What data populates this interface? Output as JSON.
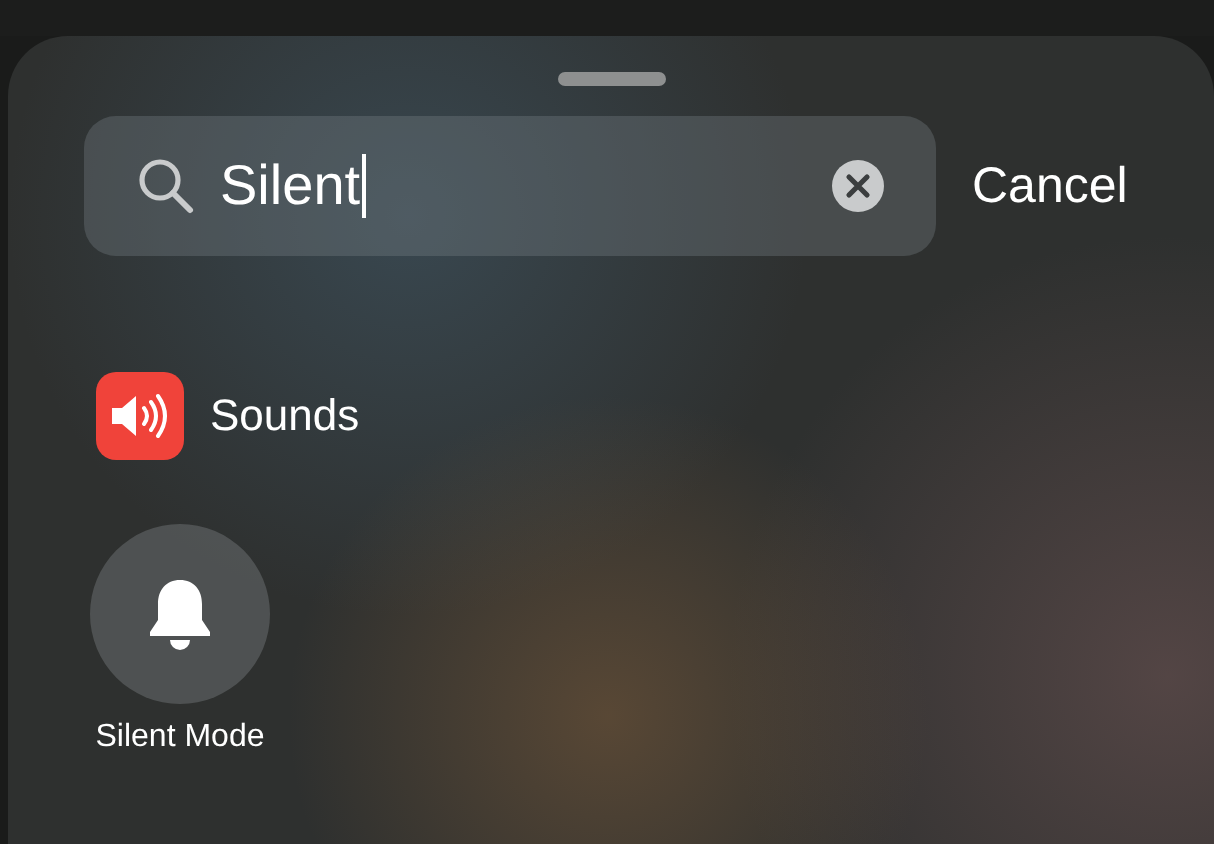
{
  "search": {
    "value": "Silent",
    "cancel": "Cancel"
  },
  "results": [
    {
      "kind": "setting",
      "label": "Sounds"
    }
  ],
  "controls": [
    {
      "kind": "toggle",
      "label": "Silent Mode",
      "on": false
    }
  ]
}
